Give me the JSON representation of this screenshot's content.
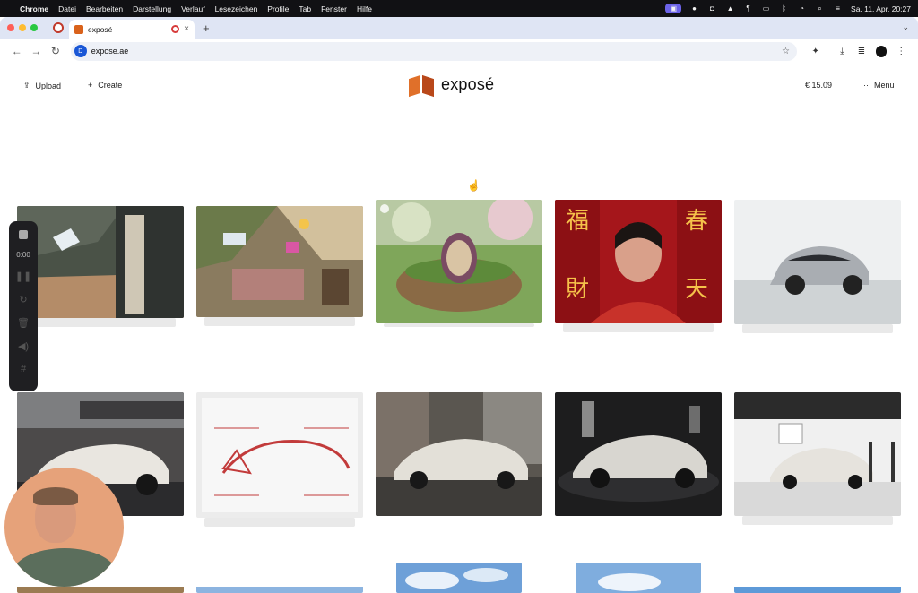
{
  "menubar": {
    "apple": "",
    "items": [
      "Chrome",
      "Datei",
      "Bearbeiten",
      "Darstellung",
      "Verlauf",
      "Lesezeichen",
      "Profile",
      "Tab",
      "Fenster",
      "Hilfe"
    ],
    "datetime": "Sa. 11. Apr.  20:27"
  },
  "browser": {
    "tab_title": "exposé",
    "url": "expose.ae",
    "new_tab": "+",
    "site_badge": "D"
  },
  "header": {
    "upload_label": "Upload",
    "create_label": "Create",
    "logo_text": "exposé",
    "balance": "€  15.09",
    "menu_label": "Menu"
  },
  "recording": {
    "timer": "0:00"
  },
  "colors": {
    "accent_logo_light": "#e0702a",
    "accent_logo_dark": "#b9481a",
    "macos_menubar": "#111114",
    "tabstrip": "#dfe5f4"
  },
  "gallery": {
    "row1": [
      "attic loft with skylights",
      "cluttered attic bedroom",
      "easter egg in basket",
      "portrait with red lantern characters",
      "electric car in white studio"
    ],
    "row2": [
      "white sports car under bridge",
      "sketch of car design",
      "white sedan in old courtyard",
      "white sedan in dark studio",
      "white sedan in photo studio"
    ]
  }
}
